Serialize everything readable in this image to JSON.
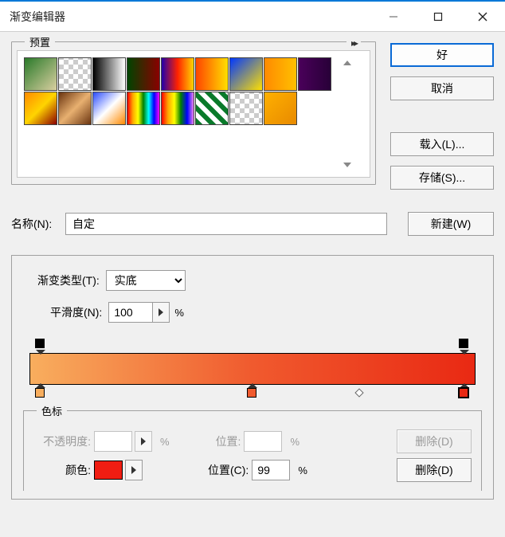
{
  "window": {
    "title": "渐变编辑器"
  },
  "presets": {
    "label": "预置",
    "swatch_gradients": [
      "linear-gradient(135deg,#2a7a2a,#d9cfa0)",
      "repeating-conic-gradient(#ccc 0 25%,#fff 0 50%) 0/12px 12px",
      "linear-gradient(90deg,#000,#fff)",
      "linear-gradient(90deg,#004400,#8a0000)",
      "linear-gradient(90deg,#2200aa,#ff2200,#ffd400)",
      "linear-gradient(90deg,#ff4400,#ffe000)",
      "linear-gradient(135deg,#0038ff,#ffe000)",
      "linear-gradient(90deg,#ff8a00,#ffc000)",
      "linear-gradient(90deg,#4a005a,#280038)",
      "linear-gradient(135deg,#ff8a00,#ffd400,#8a0000)",
      "linear-gradient(135deg,#6a3410,#e8b070,#6a3410)",
      "linear-gradient(135deg,#2a4bff,#fff,#ff8a00)",
      "linear-gradient(90deg,red,orange,yellow,green,cyan,blue,magenta)",
      "linear-gradient(90deg,red,orange,yellow,green,blue,violet)",
      "repeating-linear-gradient(45deg,#0a7a2a 0 6px,#fff 6px 12px)",
      "repeating-conic-gradient(#ccc 0 25%,#fff 0 50%) 0/12px 12px",
      "linear-gradient(135deg,#ffb000,#e88a00)"
    ]
  },
  "buttons": {
    "ok": "好",
    "cancel": "取消",
    "load": "载入(L)...",
    "save": "存储(S)...",
    "new": "新建(W)",
    "delete": "删除(D)"
  },
  "name": {
    "label": "名称(N):",
    "value": "自定"
  },
  "gradient": {
    "type_label": "渐变类型(T):",
    "type_value": "实底",
    "smoothness_label": "平滑度(N):",
    "smoothness_value": "100",
    "percent": "%",
    "bar_css": "linear-gradient(to right,#f8ae5e 0%,#f05a2e 50%,#e92913 100%)",
    "top_stops": [
      {
        "pos_pct": 2.5
      },
      {
        "pos_pct": 97.5
      }
    ],
    "bottom_stops": [
      {
        "pos_pct": 2.5,
        "color": "#f8ae5e"
      },
      {
        "pos_pct": 50,
        "color": "#f05a2e"
      },
      {
        "pos_pct": 97.5,
        "color": "#e92913",
        "selected": true
      }
    ],
    "mid_diamonds": [
      {
        "pos_pct": 74
      }
    ]
  },
  "color_stops": {
    "frame_label": "色标",
    "opacity_label": "不透明度:",
    "opacity_value": "",
    "opacity_pos_label": "位置:",
    "opacity_pos_value": "",
    "color_label": "颜色:",
    "color_value": "#f01d12",
    "color_pos_label": "位置(C):",
    "color_pos_value": "99"
  }
}
